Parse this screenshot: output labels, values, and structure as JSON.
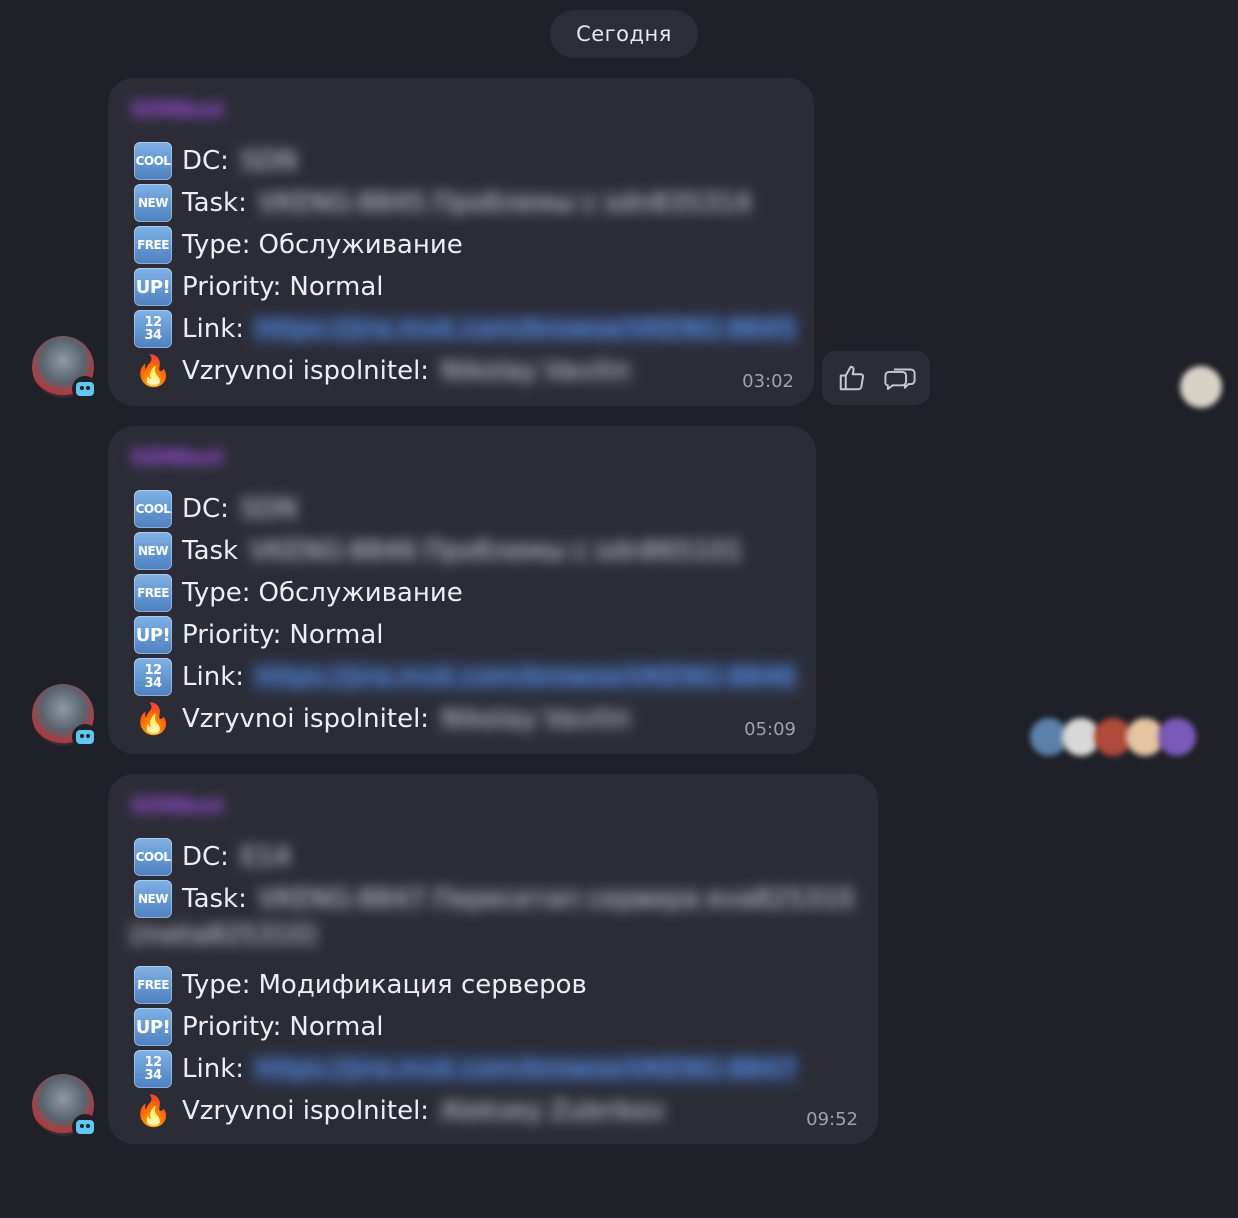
{
  "date_chip": "Сегодня",
  "messages": [
    {
      "sender": "SDNbot",
      "dc_label": "DC:",
      "dc_value": "SDN",
      "task_label": "Task:",
      "task_value": "VKENG-8845 Проблемы с sdn835314",
      "task_extra": "",
      "type_label": "Type:",
      "type_value": "Обслуживание",
      "priority_label": "Priority:",
      "priority_value": "Normal",
      "link_label": "Link:",
      "link_value": "https://jira.mvk.com/browse/VKENG-8845",
      "exec_label": "Vzryvnoi ispolnitel:",
      "exec_value": "Nikolay Vavilin",
      "time": "03:02"
    },
    {
      "sender": "SDNbot",
      "dc_label": "DC:",
      "dc_value": "SDN",
      "task_label": "Task",
      "task_value": "VKENG-8846 Проблемы с sdn865101",
      "task_extra": "",
      "type_label": "Type:",
      "type_value": "Обслуживание",
      "priority_label": "Priority:",
      "priority_value": "Normal",
      "link_label": "Link:",
      "link_value": "https://jira.mvk.com/browse/VKENG-8846",
      "exec_label": "Vzryvnoi ispolnitel:",
      "exec_value": "Nikolay Vavilin",
      "time": "05:09"
    },
    {
      "sender": "SDNbot",
      "dc_label": "DC:",
      "dc_value": "E14",
      "task_label": "Task:",
      "task_value": "VKENG-8847 Пересетап сервера eva825310",
      "task_extra": "(meta825310)",
      "type_label": "Type:",
      "type_value": "Модификация серверов",
      "priority_label": "Priority:",
      "priority_value": "Normal",
      "link_label": "Link:",
      "link_value": "https://jira.mvk.com/browse/VKENG-8847",
      "exec_label": "Vzryvnoi ispolnitel:",
      "exec_value": "Aleksey Zubrikov",
      "time": "09:52"
    }
  ],
  "emoji_icons": {
    "cool": "COOL",
    "new": "NEW",
    "free": "FREE",
    "up": "UP!",
    "num_top": "12",
    "num_bottom": "34",
    "fire": "🔥"
  },
  "colors": {
    "background": "#1f2028",
    "bubble": "#2b2c36",
    "accent_link": "#5da0ff",
    "sender": "#9a4fd8"
  }
}
